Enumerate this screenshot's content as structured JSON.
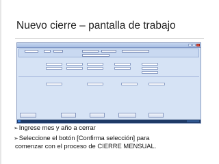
{
  "slide": {
    "title": "Nuevo cierre – pantalla de trabajo",
    "bullets": [
      "Ingrese mes y año a cerrar",
      "Seleccione el botón [Confirma selección] para",
      "comenzar con el proceso de CIERRE MENSUAL."
    ],
    "bullet_marker": "➢"
  },
  "app": {
    "accent": "#d6e3f5",
    "window_controls": [
      "minimize-icon",
      "maximize-icon",
      "close-icon"
    ]
  }
}
